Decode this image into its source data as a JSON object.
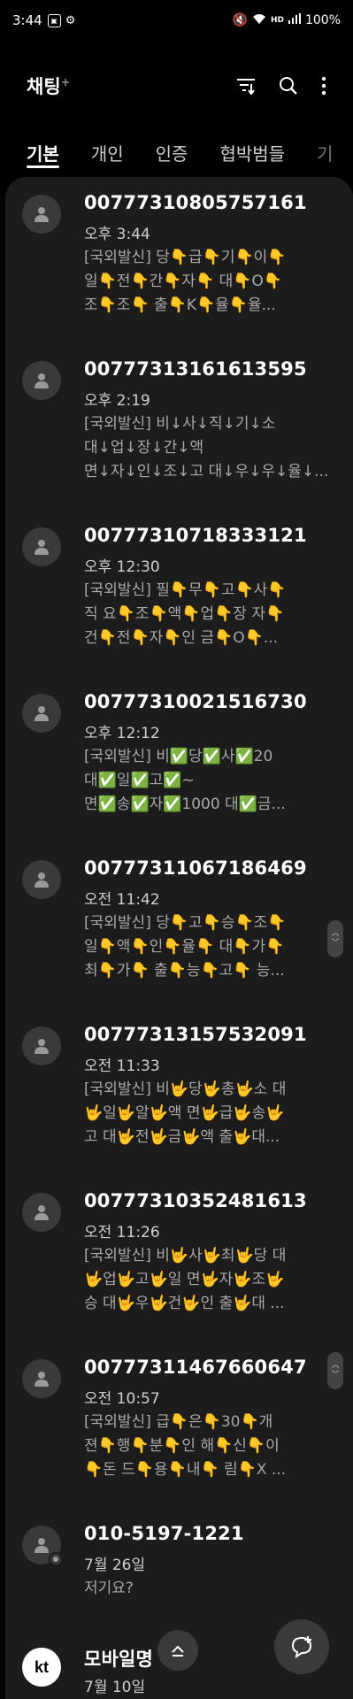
{
  "status_bar": {
    "time": "3:44",
    "battery": "100%",
    "network": "HD",
    "icons": [
      "photo-icon",
      "settings-icon",
      "mute-icon",
      "wifi-icon",
      "signal-icon"
    ]
  },
  "header": {
    "title": "채팅",
    "title_suffix": "+",
    "actions": [
      "filter-icon",
      "search-icon",
      "more-icon"
    ]
  },
  "tabs": [
    {
      "label": "기본",
      "active": true
    },
    {
      "label": "개인",
      "active": false
    },
    {
      "label": "인증",
      "active": false
    },
    {
      "label": "협박범들",
      "active": false
    },
    {
      "label": "기",
      "active": false
    }
  ],
  "conversations": [
    {
      "sender": "00777310805757161",
      "time": "오후 3:44",
      "preview": "[국외발신] 당👇급👇기👇이👇\n일👇전👇간👇자👇 대👇O👇\n조👇조👇 출👇K👇율👇율..."
    },
    {
      "sender": "00777313161613595",
      "time": "오후 2:19",
      "preview": "[국외발신] 비↓사↓직↓기↓소\n대↓업↓장↓간↓액\n면↓자↓인↓조↓고 대↓우↓우↓율↓..."
    },
    {
      "sender": "00777310718333121",
      "time": "오후 12:30",
      "preview": "[국외발신] 필👇무👇고👇사👇\n직 요👇조👇액👇업👇장 자👇\n건👇전👇자👇인 금👇O👇..."
    },
    {
      "sender": "00777310021516730",
      "time": "오후 12:12",
      "preview": "[국외발신] 비✅당✅사✅20\n대✅일✅고✅~\n면✅송✅자✅1000 대✅금..."
    },
    {
      "sender": "00777311067186469",
      "time": "오전 11:42",
      "preview": "[국외발신] 당👇고👇승👇조👇\n일👇액👇인👇율👇 대👇가👇\n최👇가👇 출👇능👇고👇 능..."
    },
    {
      "sender": "00777313157532091",
      "time": "오전 11:33",
      "preview": "[국외발신] 비🤟당🤟총🤟소 대\n🤟일🤟알🤟액 면🤟급🤟송🤟\n고 대🤟전🤟금🤟액 출🤟대..."
    },
    {
      "sender": "00777310352481613",
      "time": "오전 11:26",
      "preview": "[국외발신] 비🤟사🤟최🤟당 대\n🤟업🤟고🤟일 면🤟자🤟조🤟\n승 대🤟우🤟건🤟인 출🤟대 ..."
    },
    {
      "sender": "00777311467660647",
      "time": "오전 10:57",
      "preview": "[국외발신] 급👇은👇30👇개\n젼👇행👇분👇인 해👇신👇이\n👇돈 드👇용👇내👇 림👇X ..."
    },
    {
      "sender": "010-5197-1221",
      "time": "7월 26일",
      "preview": "저기요?"
    },
    {
      "sender": "모바일명",
      "time": "7월 10일",
      "preview": ""
    }
  ],
  "kt_logo_text": "kt"
}
